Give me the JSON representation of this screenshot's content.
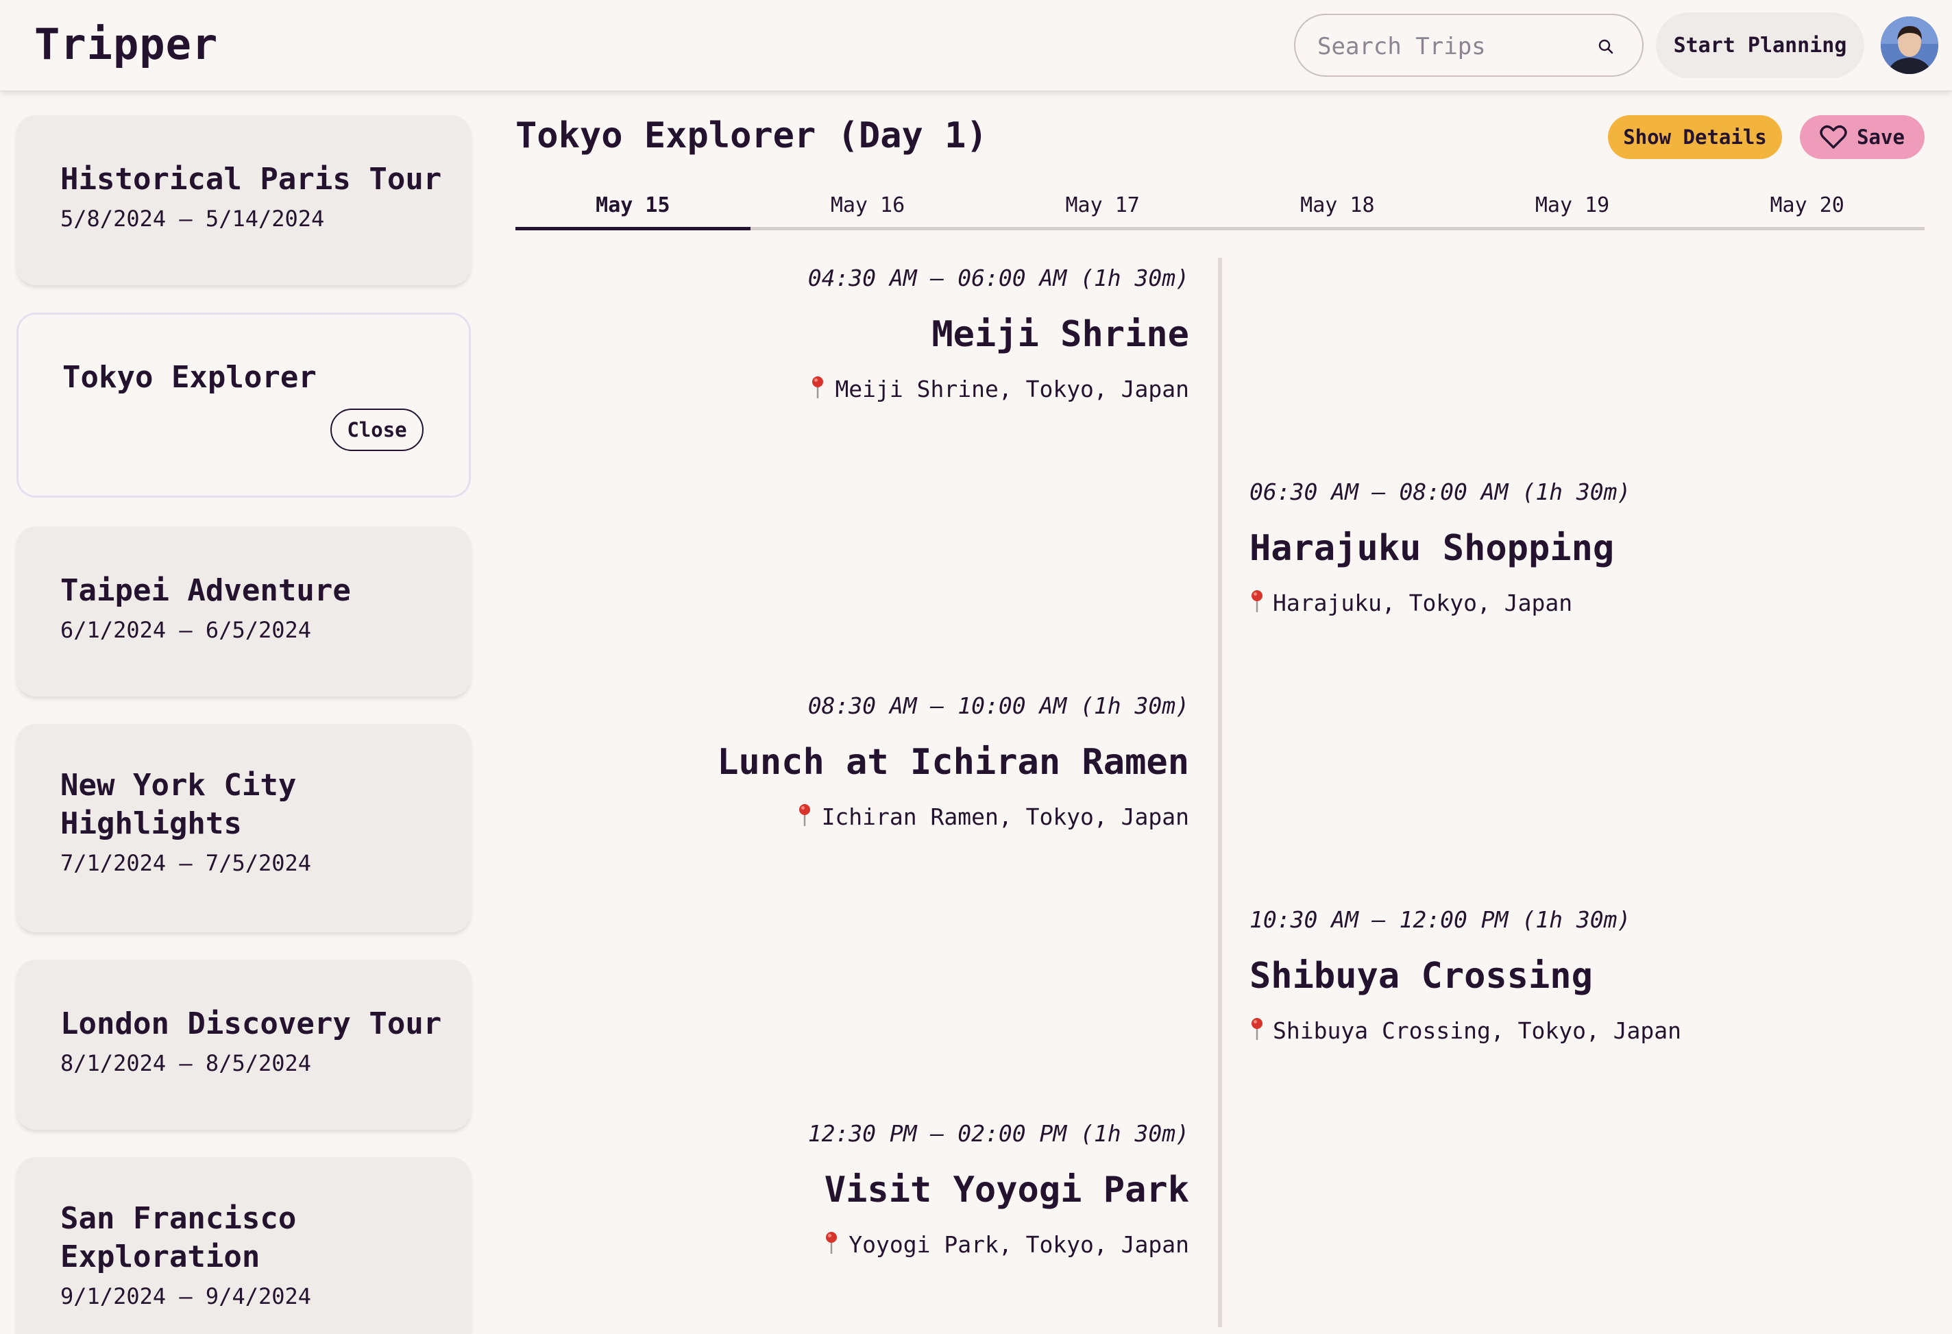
{
  "app": {
    "title": "Tripper"
  },
  "header": {
    "search_placeholder": "Search Trips",
    "start_planning": "Start Planning"
  },
  "sidebar": {
    "trips": [
      {
        "name": "Historical Paris Tour",
        "dates": "5/8/2024 – 5/14/2024"
      },
      {
        "name": "Tokyo Explorer",
        "close_label": "Close"
      },
      {
        "name": "Taipei Adventure",
        "dates": "6/1/2024 – 6/5/2024"
      },
      {
        "name": "New York City Highlights",
        "dates": "7/1/2024 – 7/5/2024"
      },
      {
        "name": "London Discovery Tour",
        "dates": "8/1/2024 – 8/5/2024"
      },
      {
        "name": "San Francisco Exploration",
        "dates": "9/1/2024 – 9/4/2024"
      }
    ]
  },
  "main": {
    "title": "Tokyo Explorer (Day 1)",
    "show_details": "Show Details",
    "save": "Save",
    "tabs": [
      "May 15",
      "May 16",
      "May 17",
      "May 18",
      "May 19",
      "May 20"
    ],
    "events": [
      {
        "time": "04:30 AM – 06:00 AM (1h 30m)",
        "name": "Meiji Shrine",
        "location": "Meiji Shrine, Tokyo, Japan"
      },
      {
        "time": "06:30 AM – 08:00 AM (1h 30m)",
        "name": "Harajuku Shopping",
        "location": "Harajuku, Tokyo, Japan"
      },
      {
        "time": "08:30 AM – 10:00 AM (1h 30m)",
        "name": "Lunch at Ichiran Ramen",
        "location": "Ichiran Ramen, Tokyo, Japan"
      },
      {
        "time": "10:30 AM – 12:00 PM (1h 30m)",
        "name": "Shibuya Crossing",
        "location": "Shibuya Crossing, Tokyo, Japan"
      },
      {
        "time": "12:30 PM – 02:00 PM (1h 30m)",
        "name": "Visit Yoyogi Park",
        "location": "Yoyogi Park, Tokyo, Japan"
      }
    ]
  },
  "colors": {
    "background": "#faf6f3",
    "text": "#24132e",
    "card": "#efebe8",
    "show_details": "#f2b43c",
    "save": "#ee9cb9",
    "pin": "#d9342b"
  },
  "icons": {
    "search": "search-icon",
    "save": "heart-icon",
    "location": "pin-icon"
  }
}
